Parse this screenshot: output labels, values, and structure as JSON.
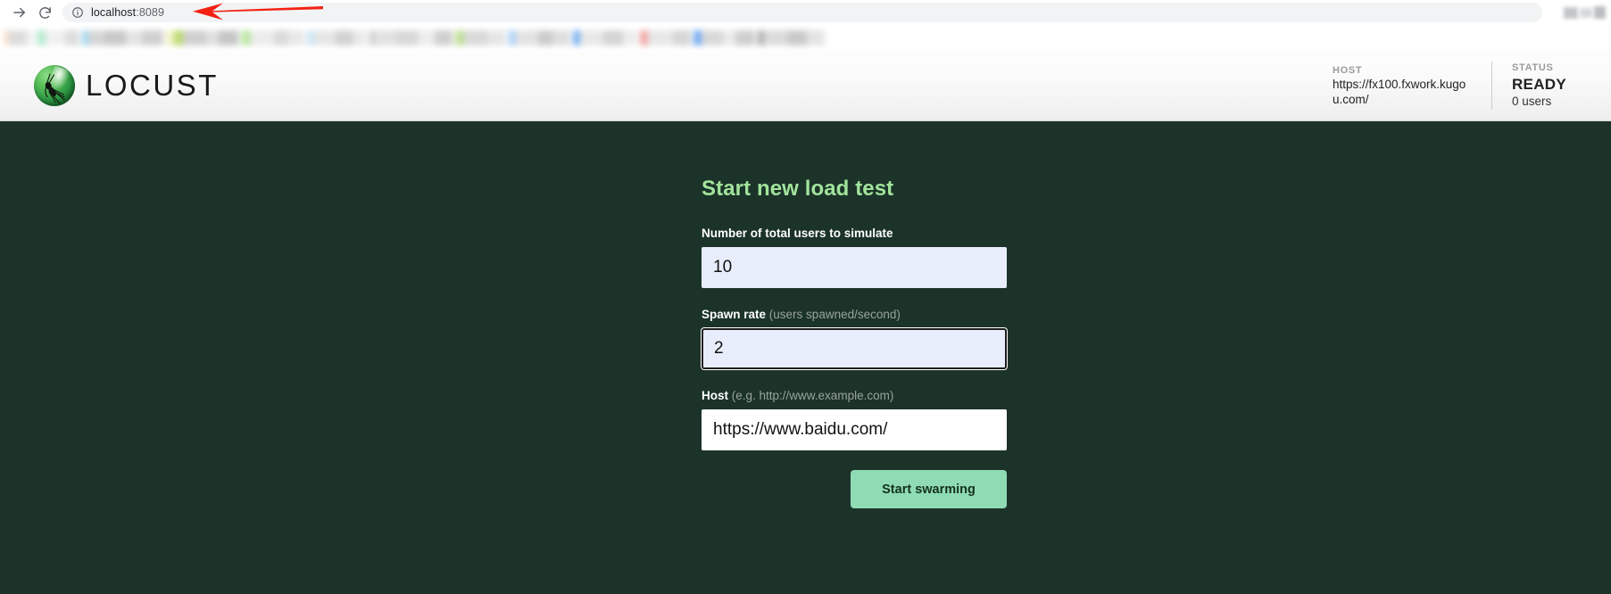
{
  "browser": {
    "forward_icon": "forward-arrow-icon",
    "reload_icon": "reload-icon",
    "site_info_icon": "site-info-icon",
    "url_host": "localhost",
    "url_port": ":8089",
    "url_full": "localhost:8089",
    "annotation": "red-left-arrow-pointing-at-url",
    "annotation_color": "#f42012"
  },
  "header": {
    "logo_icon": "locust-logo-icon",
    "brand": "LOCUST",
    "stats": [
      {
        "label": "HOST",
        "value": "https://fx100.fxwork.kugou.com/"
      },
      {
        "label": "STATUS",
        "value": "READY",
        "sub": "0 users"
      }
    ]
  },
  "form": {
    "title": "Start new load test",
    "fields": [
      {
        "label": "Number of total users to simulate",
        "hint": "",
        "value": "10",
        "placeholder": ""
      },
      {
        "label": "Spawn rate",
        "hint": "(users spawned/second)",
        "value": "2",
        "placeholder": ""
      },
      {
        "label": "Host",
        "hint": "(e.g. http://www.example.com)",
        "value": "https://www.baidu.com/",
        "placeholder": ""
      }
    ],
    "submit_label": "Start swarming"
  },
  "colors": {
    "page_background": "#1b3329",
    "title_green": "#a2e39b",
    "button_green": "#8fdcb4",
    "input_blue": "#e8edfb",
    "input_white": "#ffffff"
  }
}
